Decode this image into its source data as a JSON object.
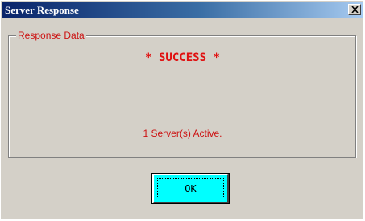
{
  "window": {
    "title": "Server Response",
    "close_label": "X"
  },
  "group": {
    "legend": "Response Data",
    "success_text": "* SUCCESS *",
    "status_text": "1 Server(s) Active."
  },
  "buttons": {
    "ok_label": "OK"
  },
  "colors": {
    "titlebar_start": "#0a246a",
    "titlebar_end": "#a6caf0",
    "dialog_face": "#d4d0c8",
    "message_text": "#cc1111",
    "ok_button_face": "#00ffff"
  }
}
